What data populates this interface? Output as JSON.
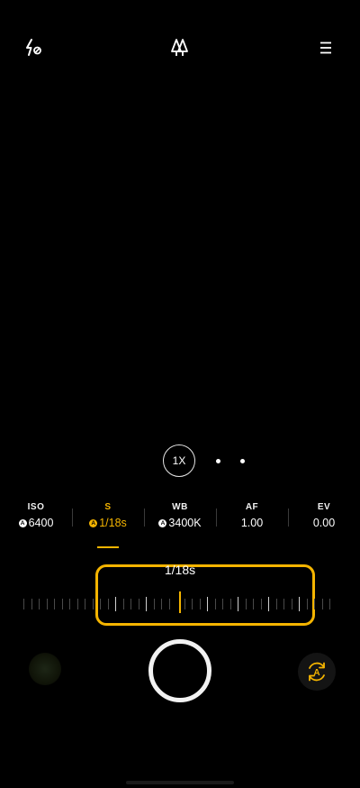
{
  "top_bar": {
    "flash_icon": "flash-off-icon",
    "mode_icon": "tree-mode-icon",
    "menu_icon": "menu-icon"
  },
  "zoom": {
    "main_label": "1X"
  },
  "params": {
    "iso": {
      "label": "ISO",
      "value": "6400",
      "auto": true
    },
    "shutter": {
      "label": "S",
      "value": "1/18s",
      "auto": true,
      "active": true
    },
    "wb": {
      "label": "WB",
      "value": "3400K",
      "auto": true
    },
    "af": {
      "label": "AF",
      "value": "1.00"
    },
    "ev": {
      "label": "EV",
      "value": "0.00"
    }
  },
  "dial": {
    "current_value": "1/18s"
  },
  "bottom_bar": {
    "gallery_icon": "gallery-thumbnail",
    "shutter_icon": "shutter-button",
    "auto_icon": "auto-reset-icon",
    "auto_label": "A"
  },
  "colors": {
    "accent": "#f4b400",
    "background": "#000000",
    "text": "#ffffff"
  }
}
